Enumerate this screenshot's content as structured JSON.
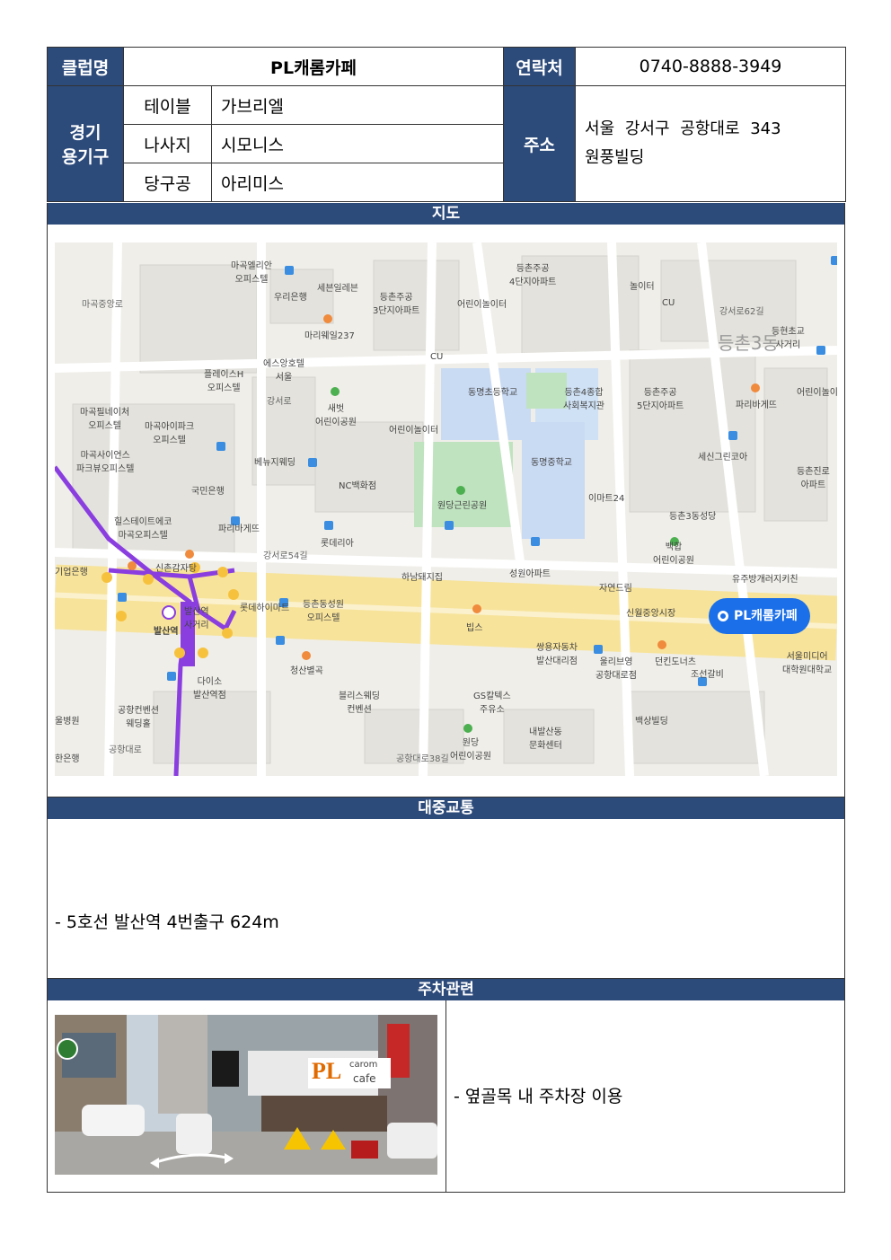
{
  "info": {
    "club_label": "클럽명",
    "club_name": "PL캐롬카페",
    "contact_label": "연락처",
    "contact_value": "0740-8888-3949",
    "equipment_label_1": "경기",
    "equipment_label_2": "용기구",
    "equipment": [
      {
        "label": "테이블",
        "value": "가브리엘"
      },
      {
        "label": "나사지",
        "value": "시모니스"
      },
      {
        "label": "당구공",
        "value": "아리미스"
      }
    ],
    "address_label": "주소",
    "address_line1": "서울 강서구 공항대로 343",
    "address_line2": "원풍빌딩"
  },
  "map": {
    "header": "지도",
    "pin_label": "PL캐롬카페",
    "labels": {
      "l1": "마곡엘리안\n오피스텔",
      "l2": "우리은행",
      "l3": "세븐일레븐",
      "l4": "등촌주공\n3단지아파트",
      "l5": "어린이놀이터",
      "l6": "등촌주공\n4단지아파트",
      "l7": "놀이터",
      "l8": "마리웨일237",
      "l9": "플레이스H\n오피스텔",
      "l10": "에스앙호텔\n서울",
      "l11": "동명초등학교",
      "l12": "등촌4종합\n사회복지관",
      "l13": "등촌주공\n5단지아파트",
      "l14": "파리바게뜨",
      "l15": "마곡필네이처\n오피스텔",
      "l16": "마곡아이파크\n오피스텔",
      "l17": "새벗\n어린이공원",
      "l18": "어린이놀이터",
      "l19": "마곡사이언스\n파크뷰오피스텔",
      "l20": "베뉴지웨딩",
      "l21": "NC백화점",
      "l22": "동명중학교",
      "l23": "세신그린코아",
      "l24": "국민은행",
      "l25": "이마트24",
      "l26": "힐스테이트에코\n마곡오피스텔",
      "l27": "원당근린공원",
      "l28": "등촌3동성당",
      "l29": "파리바게뜨",
      "l30": "롯데리아",
      "l31": "백합\n어린이공원",
      "l32": "기업은행",
      "l33": "신촌감자탕",
      "l34": "하남돼지집",
      "l35": "성원아파트",
      "l36": "자연드림",
      "l37": "유주방개러지키친",
      "l38": "롯데하이마트",
      "l39": "등촌동성원\n오피스텔",
      "l40": "신월중앙시장",
      "l41": "발산역",
      "l42": "발산역\n사거리",
      "l43": "빕스",
      "l44": "쌍용자동차\n발산대리점",
      "l45": "울리브영\n공항대로점",
      "l46": "던킨도너츠",
      "l47": "조선갈비",
      "l48": "서울미디어\n대학원대학교",
      "l49": "청산별곡",
      "l50": "다이소\n발산역점",
      "l51": "공항컨벤션\n웨딩홀",
      "l52": "블리스웨딩\n컨벤션",
      "l53": "GS칼텍스\n주유소",
      "l54": "백상빌딩",
      "l55": "내발산동\n문화센터",
      "l56": "원당\n어린이공원",
      "l57": "한은행",
      "l58": "등촌3동",
      "l59": "등현초교\n사거리",
      "l60": "강서로54길",
      "l61": "공항대로38길",
      "l62": "CU",
      "l63": "CU",
      "l64": "울병원",
      "l65": "강서로",
      "l66": "어린이놀이",
      "l67": "등촌진로\n아파트",
      "l68": "강서로62길",
      "l69": "마곡중앙로",
      "l70": "공항대로",
      "l71": "공항대로38길",
      "l72": "체육관"
    }
  },
  "transit": {
    "header": "대중교통",
    "text": "-  5호선  발산역  4번출구  624m"
  },
  "parking": {
    "header": "주차관련",
    "text": "-  옆골목  내  주차장  이용",
    "photo_sign_brand": "PL",
    "photo_sign_line1": "carom",
    "photo_sign_line2": "cafe"
  }
}
